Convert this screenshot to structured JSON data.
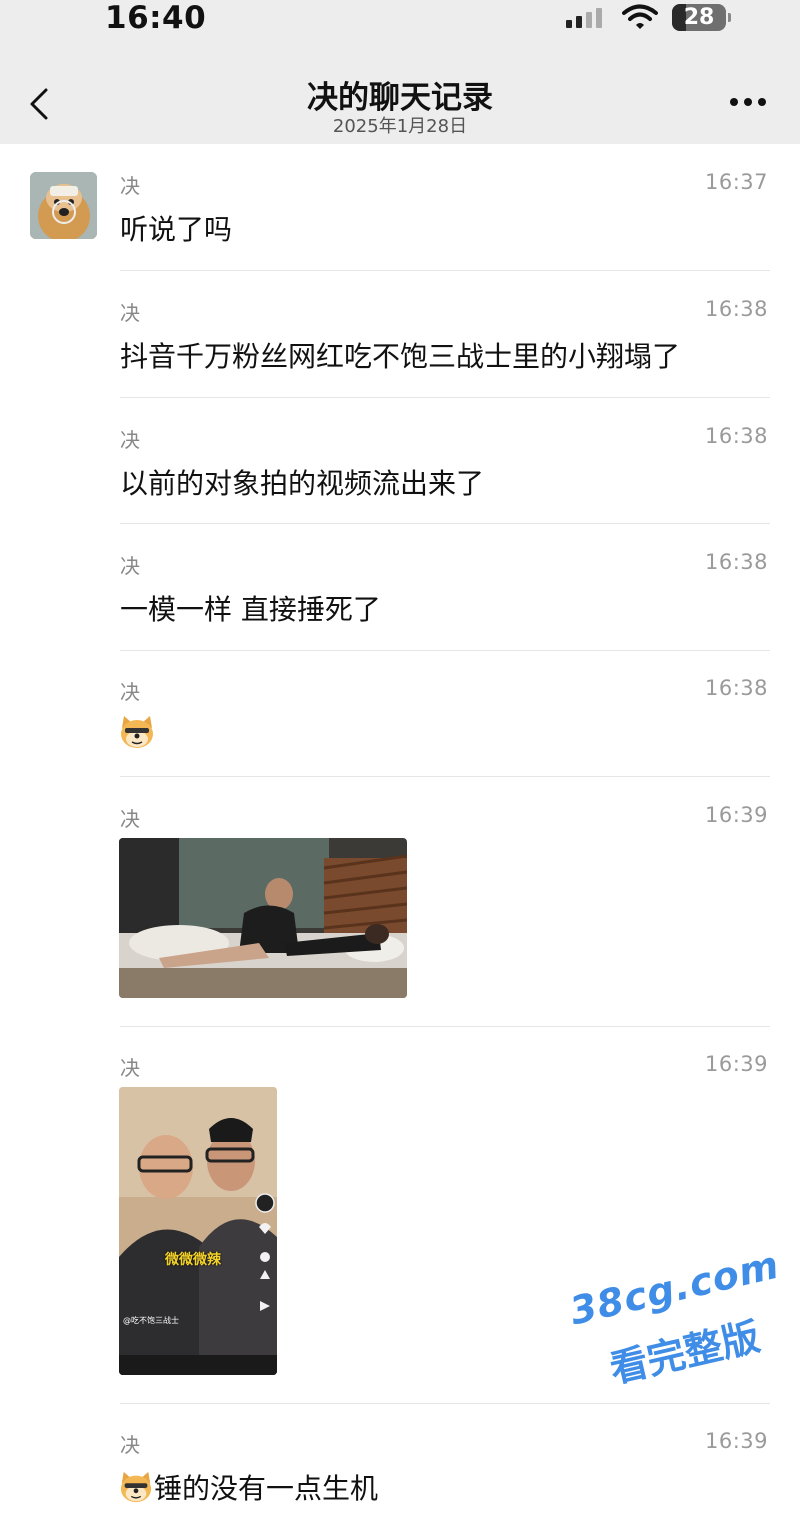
{
  "status_bar": {
    "time": "16:40",
    "battery": "28"
  },
  "header": {
    "title": "决的聊天记录",
    "subtitle": "2025年1月28日"
  },
  "messages": [
    {
      "sender": "决",
      "time": "16:37",
      "text": "听说了吗"
    },
    {
      "sender": "决",
      "time": "16:38",
      "text": "抖音千万粉丝网红吃不饱三战士里的小翔塌了"
    },
    {
      "sender": "决",
      "time": "16:38",
      "text": "以前的对象拍的视频流出来了"
    },
    {
      "sender": "决",
      "time": "16:38",
      "text": "一模一样 直接捶死了"
    },
    {
      "sender": "决",
      "time": "16:38",
      "type": "sticker",
      "sticker": "doge-emoji"
    },
    {
      "sender": "决",
      "time": "16:39",
      "type": "image",
      "image": "video-screenshot"
    },
    {
      "sender": "决",
      "time": "16:39",
      "type": "image",
      "image": "video-screenshot",
      "overlay": {
        "caption": "微微微辣",
        "account": "@吃不饱三战士"
      }
    },
    {
      "sender": "决",
      "time": "16:39",
      "text": "锤的没有一点生机",
      "leading_sticker": "doge-emoji"
    }
  ],
  "watermark": {
    "line1": "38cg.com",
    "line2": "看完整版"
  },
  "colors": {
    "nav_bg": "#ededed",
    "watermark": "#3f8de6",
    "divider": "#e6e6e6"
  }
}
